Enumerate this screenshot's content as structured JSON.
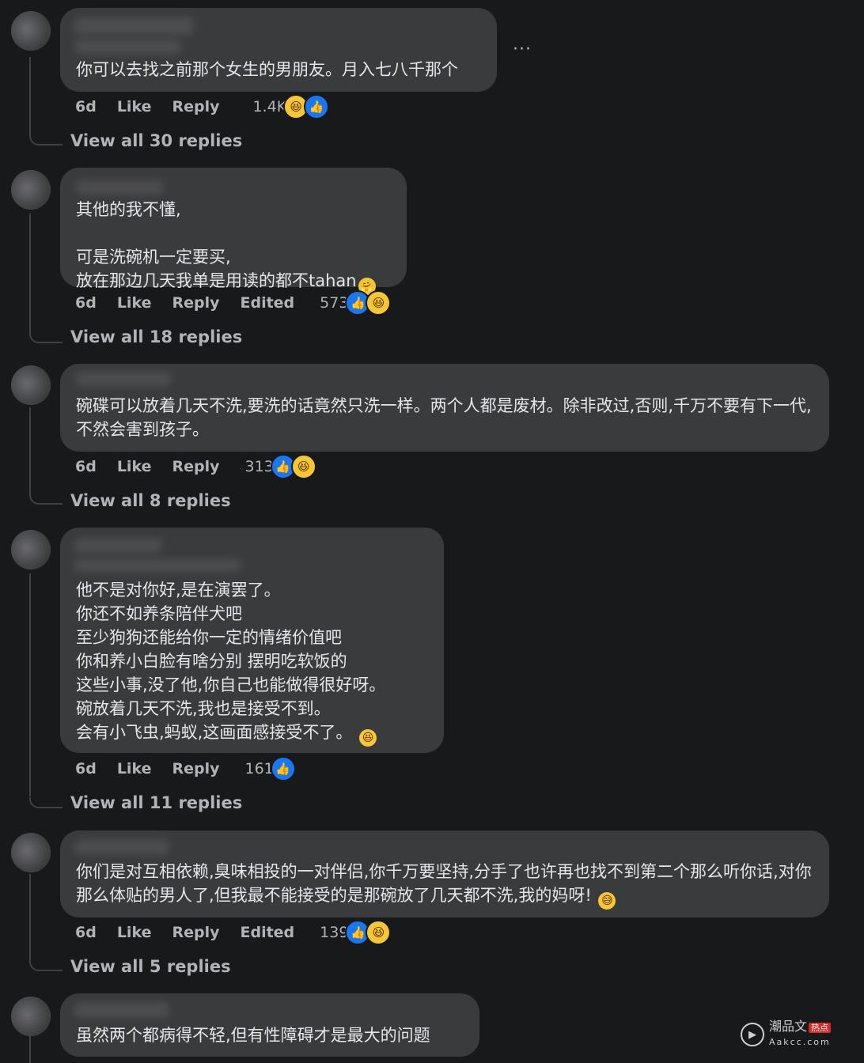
{
  "comments": [
    {
      "text": "你可以去找之前那个女生的男朋友。月入七八千那个",
      "time": "6d",
      "like": "Like",
      "reply": "Reply",
      "count": "1.4K",
      "view_replies": "View all 30 replies"
    },
    {
      "text": "其他的我不懂,\n\n可是洗碗机一定要买,\n放在那边几天我单是用读的都不tahan",
      "time": "6d",
      "like": "Like",
      "reply": "Reply",
      "edited": "Edited",
      "count": "573",
      "view_replies": "View all 18 replies"
    },
    {
      "text": "碗碟可以放着几天不洗,要洗的话竟然只洗一样。两个人都是废材。除非改过,否则,千万不要有下一代,不然会害到孩子。",
      "time": "6d",
      "like": "Like",
      "reply": "Reply",
      "count": "313",
      "view_replies": "View all 8 replies"
    },
    {
      "text": "他不是对你好,是在演罢了。\n你还不如养条陪伴犬吧\n至少狗狗还能给你一定的情绪价值吧\n你和养小白脸有啥分别 摆明吃软饭的\n这些小事,没了他,你自己也能做得很好呀。\n碗放着几天不洗,我也是接受不到。\n会有小飞虫,蚂蚁,这画面感接受不了。",
      "time": "6d",
      "like": "Like",
      "reply": "Reply",
      "count": "161",
      "view_replies": "View all 11 replies"
    },
    {
      "text": "你们是对互相依赖,臭味相投的一对伴侣,你千万要坚持,分手了也许再也找不到第二个那么听你话,对你那么体贴的男人了,但我最不能接受的是那碗放了几天都不洗,我的妈呀!",
      "time": "6d",
      "like": "Like",
      "reply": "Reply",
      "edited": "Edited",
      "count": "139",
      "view_replies": "View all 5 replies"
    },
    {
      "text": "虽然两个都病得不轻,但有性障碍才是最大的问题"
    }
  ],
  "more_icon": "···",
  "icons": {
    "like": "👍",
    "haha": "😆",
    "hug": "🤗",
    "sweat": "😅"
  },
  "watermark": {
    "line1": "潮品文",
    "tag": "热点",
    "line2": "Aakcc.com"
  }
}
